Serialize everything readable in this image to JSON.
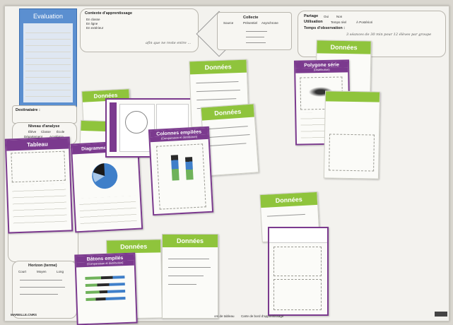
{
  "evaluation": {
    "title": "Evaluation"
  },
  "context": {
    "title": "Contexte d'apprentissage",
    "options": [
      "En classe",
      "En ligne",
      "En extérieur"
    ],
    "handwriting": "afin que ne reste entre ..."
  },
  "collecte": {
    "label_left": "Source",
    "title": "Collecte",
    "options": [
      "Présentiel",
      "Asynchrone"
    ]
  },
  "partage": {
    "title": "Partage",
    "oui": "Oui",
    "non": "Non",
    "utilisation": "Utilisation",
    "opt1": "Temps réel",
    "opt2": "À Postériori",
    "temps": "Temps d'observation :",
    "hand": "3 séances de 30 min pour 12 élèves par groupe"
  },
  "destinataire": {
    "label": "Destinataire :"
  },
  "niveau": {
    "title": "Niveau d'analyse",
    "row1": [
      "Élève",
      "Classe",
      "École"
    ],
    "row2": [
      "Département",
      "Académie"
    ]
  },
  "horizon": {
    "title": "Horizon (terme)",
    "options": [
      "Court",
      "Moyen",
      "Long"
    ]
  },
  "cards": {
    "donnees": "Données",
    "tableau": "Tableau",
    "diagramme": "Diagramme circulaire",
    "colonnes": "Colonnes empilées",
    "colonnes_sub": "(Comparaison et distribution)",
    "polygone": "Polygone série",
    "polygone_sub": "(Distribution)",
    "batons": "Bâtons empilés",
    "batons_sub": "(Comparaison et distribution)"
  },
  "footer": {
    "left": "MAREILLE.CNRS",
    "mid": "om de tableau",
    "right": "Carte de bord d'apprentissage"
  },
  "colors": {
    "green": "#8fc43c",
    "purple": "#7b3a8e",
    "blue": "#3f7fc9"
  }
}
